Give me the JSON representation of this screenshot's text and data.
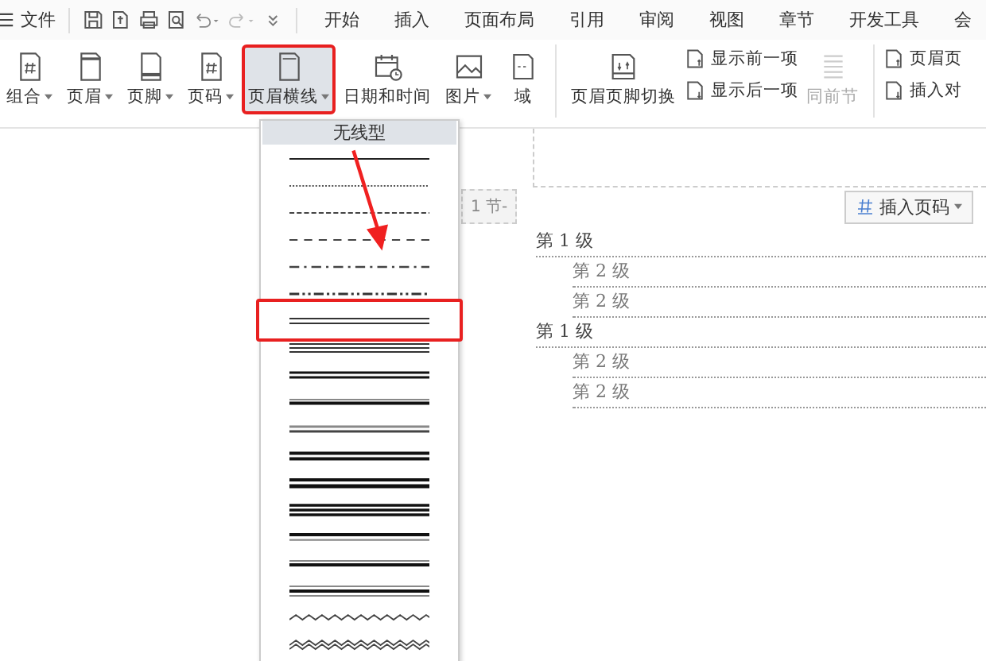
{
  "menu_bar": {
    "file_label": "文件",
    "tabs": [
      "开始",
      "插入",
      "页面布局",
      "引用",
      "审阅",
      "视图",
      "章节",
      "开发工具",
      "会"
    ]
  },
  "ribbon": {
    "groups": [
      {
        "kind": "large",
        "label": "组合",
        "dropdown": true,
        "selected": false
      },
      {
        "kind": "large",
        "label": "页眉",
        "dropdown": true,
        "selected": false
      },
      {
        "kind": "large",
        "label": "页脚",
        "dropdown": true,
        "selected": false
      },
      {
        "kind": "large",
        "label": "页码",
        "dropdown": true,
        "selected": false
      },
      {
        "kind": "large",
        "label": "页眉横线",
        "dropdown": true,
        "selected": true
      },
      {
        "kind": "large",
        "label": "日期和时间",
        "selected": false
      },
      {
        "kind": "large",
        "label": "图片",
        "dropdown": true,
        "selected": false
      },
      {
        "kind": "large",
        "label": "域",
        "selected": false
      },
      {
        "kind": "separator"
      },
      {
        "kind": "large",
        "label": "页眉页脚切换",
        "selected": false
      },
      {
        "kind": "stack",
        "items": [
          {
            "label": "显示前一项"
          },
          {
            "label": "显示后一项"
          }
        ]
      },
      {
        "kind": "large",
        "label": "同前节",
        "selected": false,
        "disabled": true
      },
      {
        "kind": "separator"
      },
      {
        "kind": "stack",
        "items": [
          {
            "label": "页眉页"
          },
          {
            "label": "插入对"
          }
        ]
      }
    ]
  },
  "line_menu": {
    "header": "无线型",
    "styles": [
      {
        "kind": "solid",
        "selected": false
      },
      {
        "kind": "dotted",
        "selected": false
      },
      {
        "kind": "fine-dashed",
        "selected": false
      },
      {
        "kind": "dashed",
        "selected": false
      },
      {
        "kind": "dash-dot",
        "selected": false
      },
      {
        "kind": "dash-dot-dot",
        "selected": false
      },
      {
        "kind": "double",
        "selected": true
      },
      {
        "kind": "triple",
        "selected": false
      },
      {
        "kind": "heavy-double",
        "selected": false
      },
      {
        "kind": "thin-thick",
        "selected": false
      },
      {
        "kind": "grey-double",
        "selected": false
      },
      {
        "kind": "thick-double",
        "selected": false
      },
      {
        "kind": "double-thick",
        "selected": false
      },
      {
        "kind": "triple-thick",
        "selected": false
      },
      {
        "kind": "thick-thin",
        "selected": false
      },
      {
        "kind": "thin-thick-grey",
        "selected": false
      },
      {
        "kind": "thin-thick-thin",
        "selected": false
      },
      {
        "kind": "wave",
        "selected": false
      },
      {
        "kind": "double-wave",
        "selected": false
      }
    ]
  },
  "document": {
    "section_tag": "1 节-",
    "insert_page_number": "插入页码",
    "toc": [
      {
        "text": "第 1 级",
        "children": [
          {
            "text": "第 2 级"
          },
          {
            "text": "第 2 级"
          }
        ]
      },
      {
        "text": "第 1 级",
        "children": [
          {
            "text": "第 2 级"
          },
          {
            "text": "第 2 级"
          }
        ]
      }
    ]
  }
}
